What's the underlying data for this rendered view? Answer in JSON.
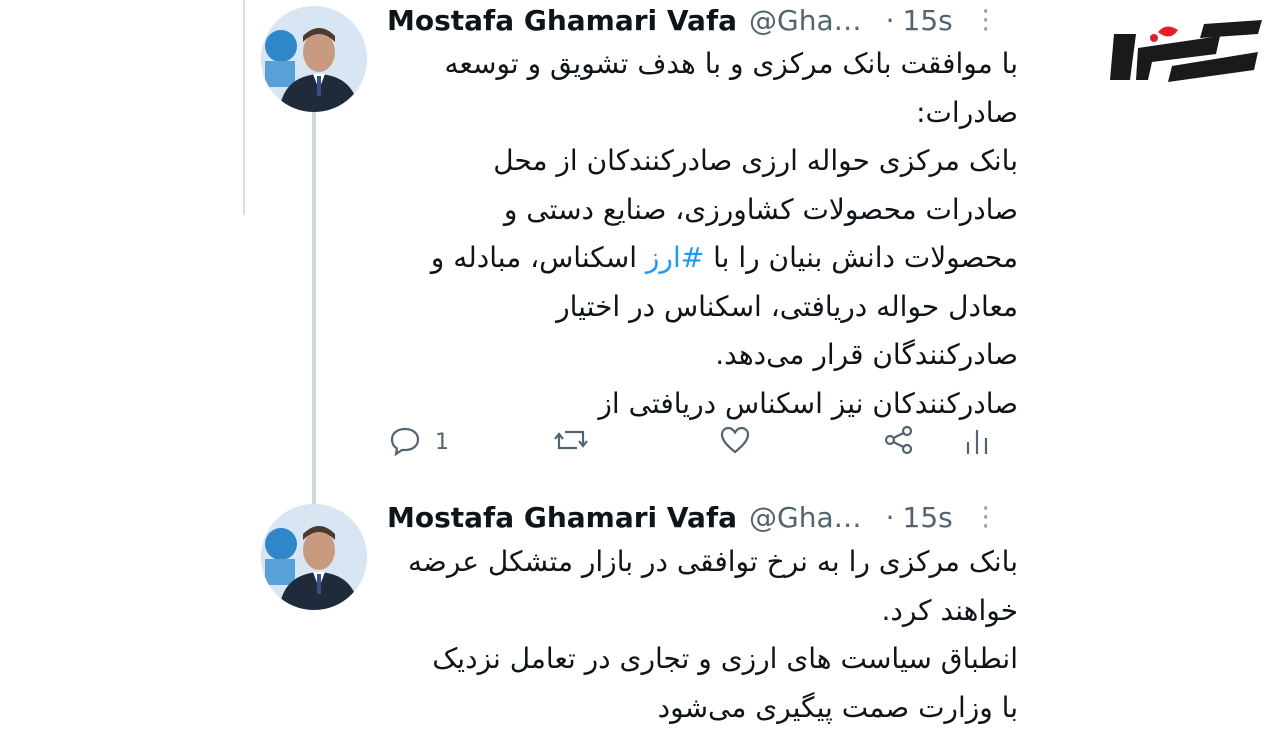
{
  "brand": {
    "accent": "#1d9bf0",
    "logo_red": "#e31e24",
    "logo_dark": "#1a1a1a"
  },
  "tweets": [
    {
      "author": "Mostafa Ghamari Vafa",
      "handle": "@Gha…",
      "separator": "·",
      "time": "15s",
      "more_icon": "more-vertical-icon",
      "lines_before_hashtag": [
        "با موافقت بانک مرکزی و با هدف تشویق و توسعه",
        "صادرات:",
        "بانک مرکزی حواله ارزی صادرکنندکان از محل",
        "صادرات محصولات کشاورزی، صنایع دستی و"
      ],
      "hashtag_line": {
        "before": "محصولات دانش بنیان را با ",
        "hashtag": "#ارز",
        "after": " اسکناس، مبادله و"
      },
      "lines_after_hashtag": [
        "معادل حواله دریافتی، اسکناس در اختیار",
        "صادرکنندگان قرار می‌دهد.",
        "صادرکنندکان نیز اسکناس دریافتی از"
      ],
      "actions": {
        "reply_count": "1"
      }
    },
    {
      "author": "Mostafa Ghamari Vafa",
      "handle": "@Gha…",
      "separator": "·",
      "time": "15s",
      "more_icon": "more-vertical-icon",
      "lines": [
        "بانک مرکزی را به نرخ توافقی در بازار متشکل عرضه",
        "خواهند کرد.",
        "انطباق سیاست های ارزی و تجاری در تعامل نزدیک",
        "با وزارت صمت پیگیری می‌شود"
      ]
    }
  ]
}
